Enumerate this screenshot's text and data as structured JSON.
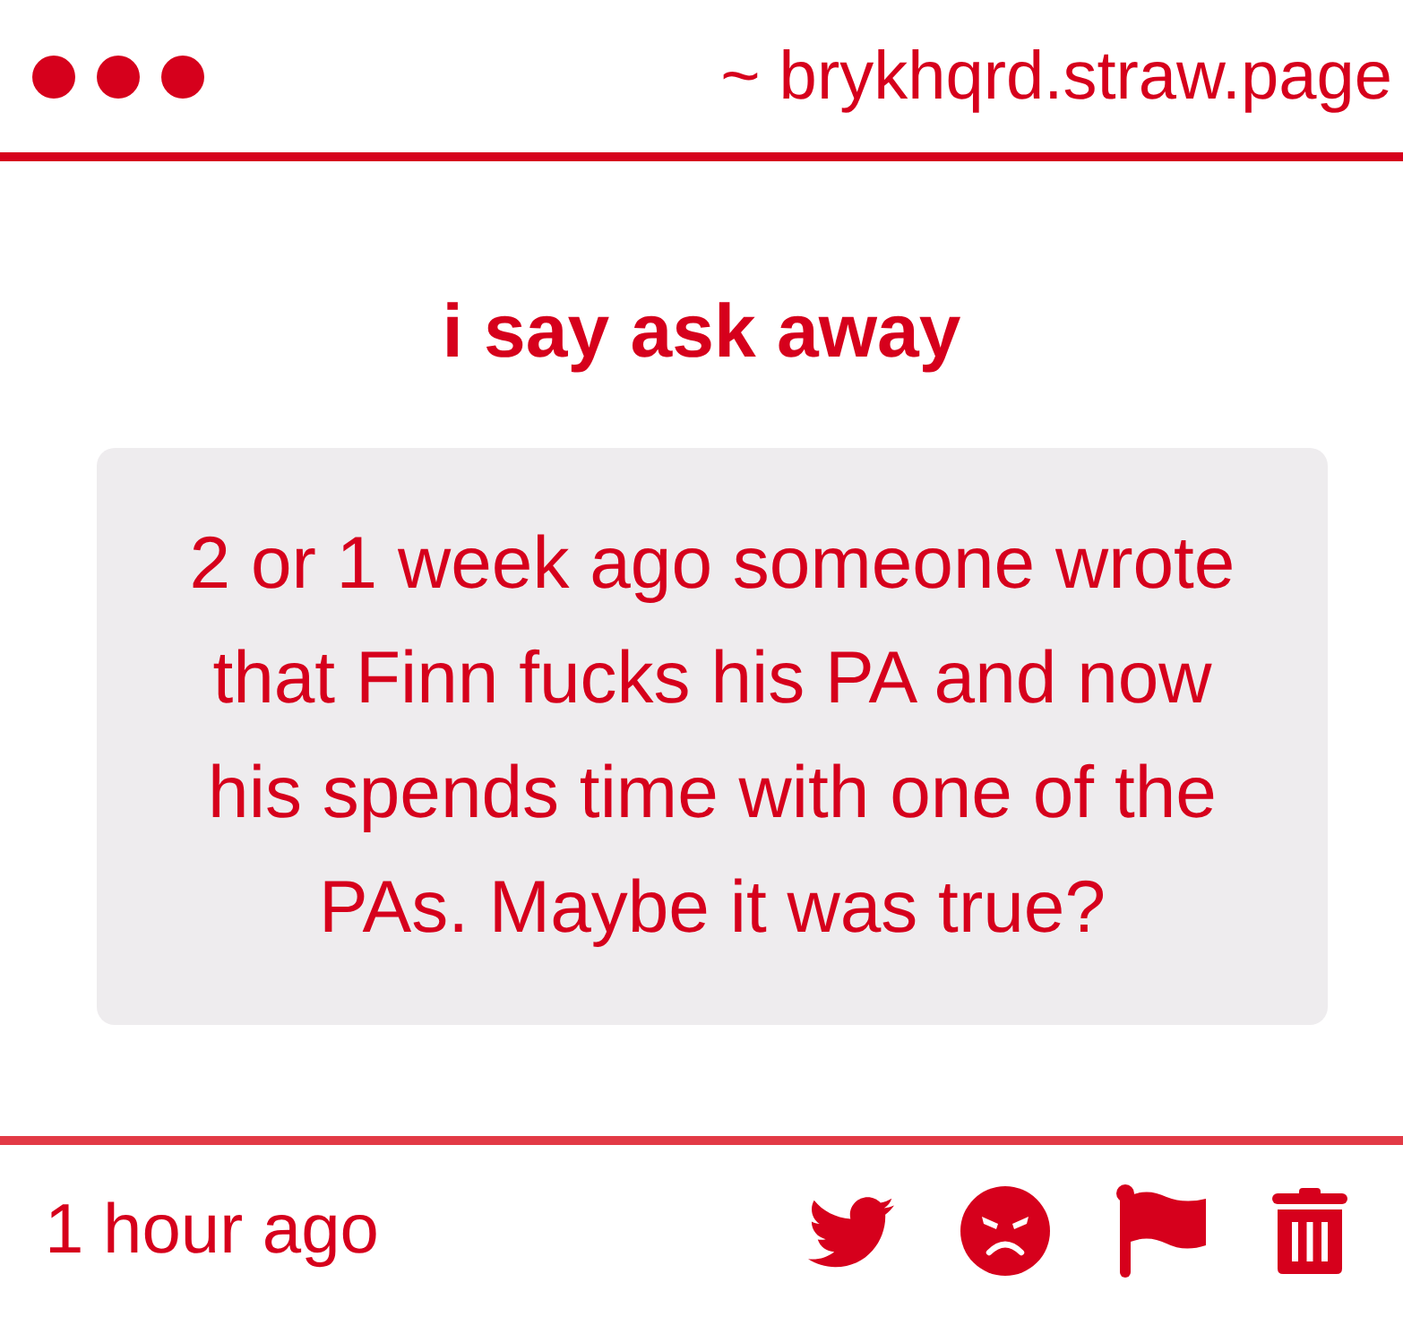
{
  "header": {
    "url": "~ brykhqrd.straw.page"
  },
  "title": "i say ask away",
  "question": {
    "text": "2 or 1 week ago someone wrote that Finn fucks his PA and now his spends time with one of the PAs. Maybe it was true?"
  },
  "footer": {
    "time": "1 hour ago"
  }
}
